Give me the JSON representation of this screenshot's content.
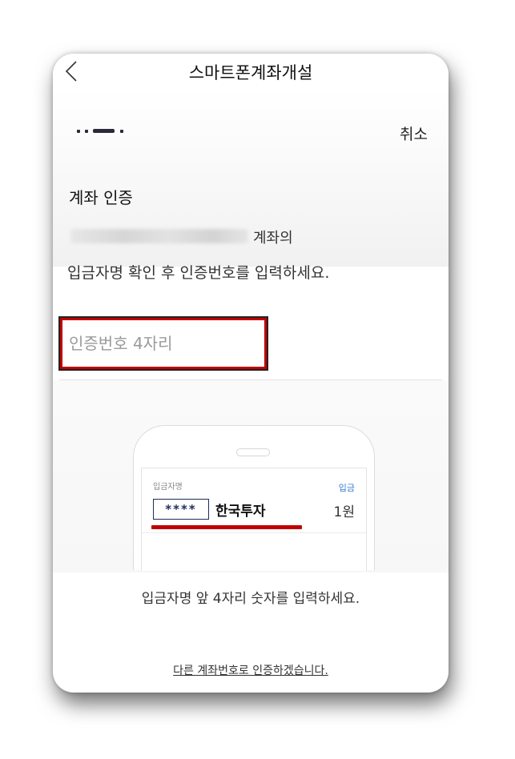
{
  "header": {
    "title": "스마트폰계좌개설",
    "cancel_label": "취소"
  },
  "section": {
    "title": "계좌 인증",
    "account_suffix": "계좌의",
    "instruction": "입금자명 확인 후 인증번호를 입력하세요."
  },
  "input": {
    "placeholder": "인증번호 4자리",
    "value": ""
  },
  "illustration": {
    "depositor_label": "입금자명",
    "deposit_label": "입금",
    "masked_code": "****",
    "company_name": "한국투자",
    "amount": "1원"
  },
  "hint": "입금자명 앞 4자리 숫자를 입력하세요.",
  "other_account_link": "다른 계좌번호로 인증하겠습니다.",
  "colors": {
    "highlight_red": "#c00000",
    "mask_border": "#1f2c5c",
    "deposit_blue": "#3a7bd5"
  },
  "icons": {
    "back": "chevron-left-icon",
    "progress": "step-progress-indicator"
  }
}
